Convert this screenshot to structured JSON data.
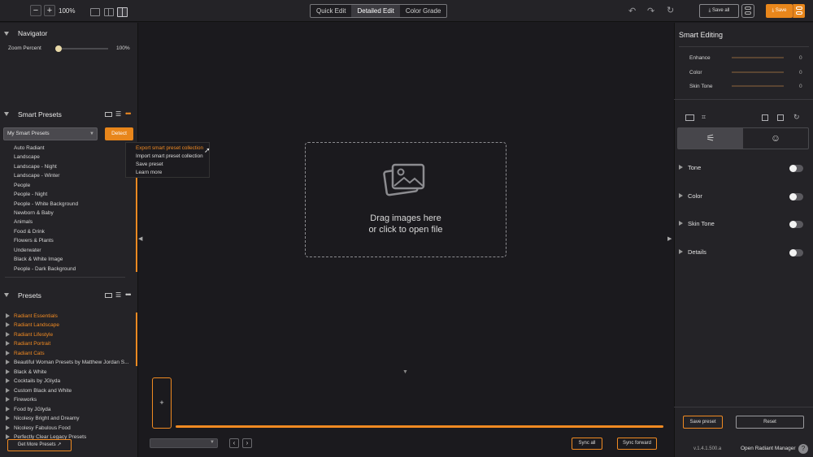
{
  "topbar": {
    "zoom_minus": "−",
    "zoom_plus": "+",
    "zoom_level": "100%",
    "modes": [
      "Quick Edit",
      "Detailed Edit",
      "Color Grade"
    ],
    "active_mode": "Detailed Edit",
    "save_all_label": "Save all",
    "save_label": "Save"
  },
  "navigator": {
    "title": "Navigator",
    "zoom_label": "Zoom Percent",
    "zoom_value": "100%"
  },
  "smart_presets": {
    "title": "Smart Presets",
    "selected_collection": "My Smart Presets",
    "detect_label": "Detect",
    "items": [
      "Auto Radiant",
      "Landscape",
      "Landscape - Night",
      "Landscape - Winter",
      "People",
      "People - Night",
      "People - White Background",
      "Newborn & Baby",
      "Animals",
      "Food & Drink",
      "Flowers & Plants",
      "Underwater",
      "Black & White Image",
      "People - Dark Background"
    ],
    "context_menu": [
      "Export smart preset collection",
      "Import smart preset collection",
      "Save preset",
      "Learn more"
    ]
  },
  "presets": {
    "title": "Presets",
    "items": [
      {
        "label": "Radiant Essentials",
        "highlight": true
      },
      {
        "label": "Radiant Landscape",
        "highlight": true
      },
      {
        "label": "Radiant Lifestyle",
        "highlight": true
      },
      {
        "label": "Radiant Portrait",
        "highlight": true
      },
      {
        "label": "Radiant Cats",
        "highlight": true
      },
      {
        "label": "Beautiful Woman Presets by Matthew Jordan S...",
        "highlight": false
      },
      {
        "label": "Black & White",
        "highlight": false
      },
      {
        "label": "Cocktails by JGlyda",
        "highlight": false
      },
      {
        "label": "Custom Black and White",
        "highlight": false
      },
      {
        "label": "Fireworks",
        "highlight": false
      },
      {
        "label": "Food by JGlyda",
        "highlight": false
      },
      {
        "label": "Nicolesy Bright and Dreamy",
        "highlight": false
      },
      {
        "label": "Nicolesy Fabulous Food",
        "highlight": false
      },
      {
        "label": "Perfectly Clear Legacy Presets",
        "highlight": false
      }
    ],
    "get_more_label": "Get More Presets"
  },
  "canvas": {
    "drop_line1": "Drag images here",
    "drop_line2": "or click to open file",
    "add_symbol": "+"
  },
  "bottom": {
    "sync_all_label": "Sync all",
    "sync_forward_label": "Sync forward"
  },
  "smart_editing": {
    "title": "Smart Editing",
    "sliders": [
      {
        "label": "Enhance",
        "value": "0"
      },
      {
        "label": "Color",
        "value": "0"
      },
      {
        "label": "Skin Tone",
        "value": "0"
      }
    ],
    "sections": [
      "Tone",
      "Color",
      "Skin Tone",
      "Details"
    ],
    "save_preset_label": "Save preset",
    "reset_label": "Reset"
  },
  "footer": {
    "version": "v.1.4.1.500.a",
    "open_manager_label": "Open Radiant Manager",
    "help_symbol": "?"
  },
  "colors": {
    "accent": "#f08a22",
    "background": "#1b1a1e",
    "panel": "#242327"
  },
  "icons": [
    "zoom-out-icon",
    "zoom-in-icon",
    "single-view-icon",
    "split-view-icon",
    "compare-view-icon",
    "undo-icon",
    "redo-icon",
    "refresh-icon",
    "save-all-icon",
    "toggle-compare-icon",
    "grid-view-icon",
    "list-view-icon",
    "more-icon",
    "image-icon",
    "crop-icon",
    "adjust-icon",
    "face-icon",
    "external-link-icon",
    "help-icon"
  ]
}
